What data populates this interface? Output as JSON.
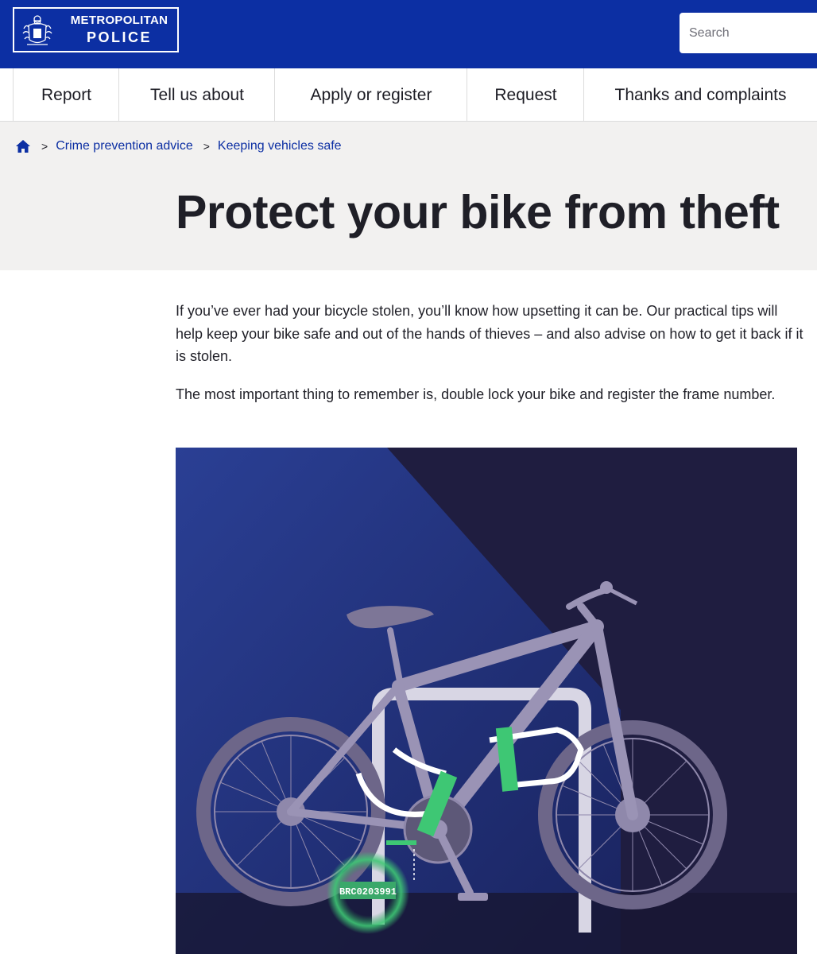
{
  "header": {
    "logo": {
      "line1": "METROPOLITAN",
      "line2": "POLICE"
    },
    "search_placeholder": "Search",
    "colors": {
      "brand_blue": "#0c2fa3",
      "band_grey": "#f2f1f0"
    }
  },
  "nav": {
    "items": [
      {
        "label": "Report"
      },
      {
        "label": "Tell us about"
      },
      {
        "label": "Apply or register"
      },
      {
        "label": "Request"
      },
      {
        "label": "Thanks and complaints"
      }
    ]
  },
  "breadcrumb": {
    "home_icon": "home-icon",
    "items": [
      {
        "label": "Crime prevention advice"
      },
      {
        "label": "Keeping vehicles safe"
      }
    ]
  },
  "page": {
    "title": "Protect your bike from theft",
    "paragraphs": [
      "If you’ve ever had your bicycle stolen, you’ll know how upsetting it can be. Our practical tips will help keep your bike safe and out of the hands of thieves – and also advise on how to get it back if it is stolen.",
      "The most important thing to remember is, double lock your bike and register the frame number."
    ]
  },
  "illustration": {
    "frame_number": "BRC0203991"
  }
}
